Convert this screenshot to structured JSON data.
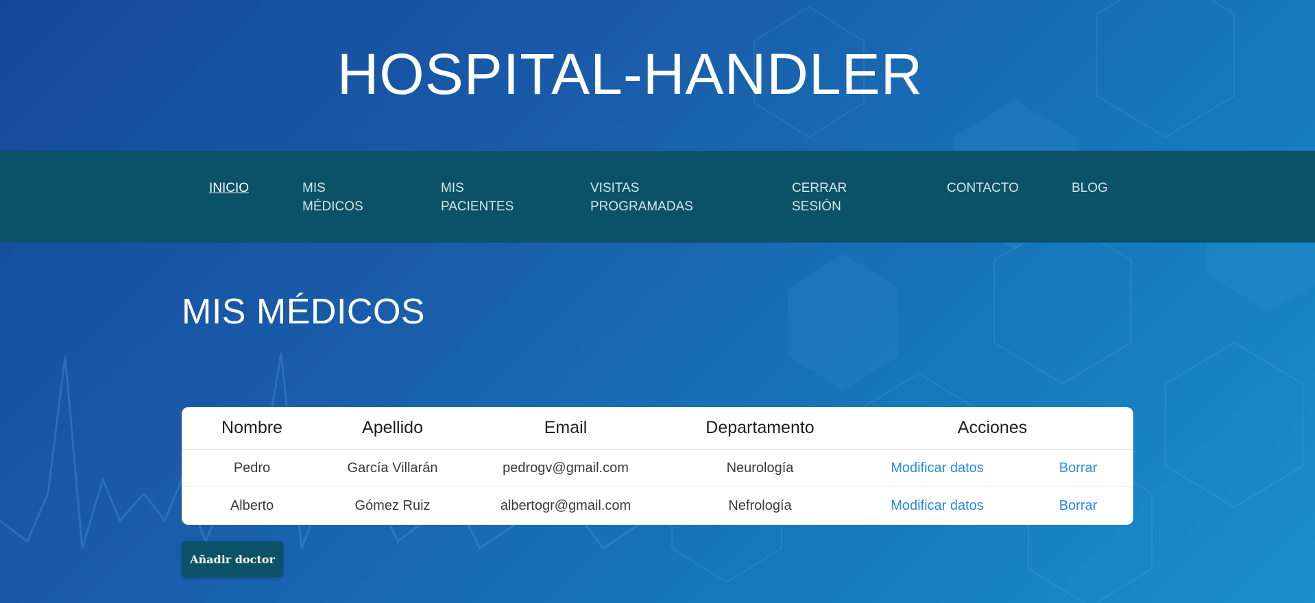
{
  "header": {
    "title": "HOSPITAL-HANDLER"
  },
  "nav": {
    "items": [
      {
        "label": "INICIO",
        "active": true
      },
      {
        "label": "MIS\nMÉDICOS",
        "active": false
      },
      {
        "label": "MIS\nPACIENTES",
        "active": false
      },
      {
        "label": "VISITAS\nPROGRAMADAS",
        "active": false
      },
      {
        "label": "CERRAR\nSESIÓN",
        "active": false
      },
      {
        "label": "CONTACTO",
        "active": false
      },
      {
        "label": "BLOG",
        "active": false
      }
    ]
  },
  "main": {
    "section_title": "MIS MÉDICOS",
    "table": {
      "headers": [
        "Nombre",
        "Apellido",
        "Email",
        "Departamento",
        "Acciones"
      ],
      "rows": [
        {
          "nombre": "Pedro",
          "apellido": "García Villarán",
          "email": "pedrogv@gmail.com",
          "departamento": "Neurología",
          "modificar_label": "Modificar datos",
          "borrar_label": "Borrar"
        },
        {
          "nombre": "Alberto",
          "apellido": "Gómez Ruiz",
          "email": "albertogr@gmail.com",
          "departamento": "Nefrología",
          "modificar_label": "Modificar datos",
          "borrar_label": "Borrar"
        }
      ]
    },
    "add_button_label": "Añadir doctor"
  },
  "colors": {
    "nav_background": "#0b5268",
    "link": "#2a8ae0",
    "page_background": "#1a5eab"
  }
}
